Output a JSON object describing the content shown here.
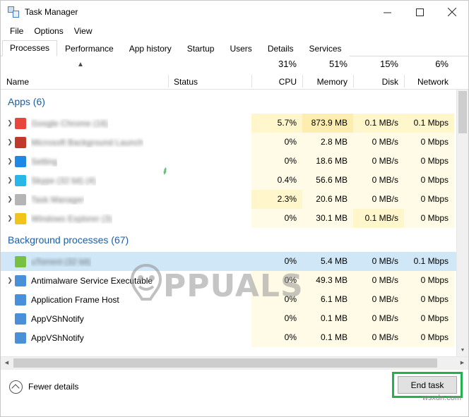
{
  "window": {
    "title": "Task Manager",
    "icon": "task-manager-icon",
    "minimize": "–",
    "maximize": "□",
    "close": "✕"
  },
  "menu": [
    "File",
    "Options",
    "View"
  ],
  "tabs": [
    {
      "label": "Processes",
      "active": true
    },
    {
      "label": "Performance",
      "active": false
    },
    {
      "label": "App history",
      "active": false
    },
    {
      "label": "Startup",
      "active": false
    },
    {
      "label": "Users",
      "active": false
    },
    {
      "label": "Details",
      "active": false
    },
    {
      "label": "Services",
      "active": false
    }
  ],
  "columns": [
    {
      "name": "Name",
      "pct": ""
    },
    {
      "name": "Status",
      "pct": ""
    },
    {
      "name": "CPU",
      "pct": "31%"
    },
    {
      "name": "Memory",
      "pct": "51%"
    },
    {
      "name": "Disk",
      "pct": "15%"
    },
    {
      "name": "Network",
      "pct": "6%"
    }
  ],
  "groups": [
    {
      "label": "Apps (6)"
    },
    {
      "label": "Background processes (67)"
    }
  ],
  "rows": [
    {
      "group": 0,
      "name": "Google Chrome (16)",
      "blurred": true,
      "icon": "#e8453c",
      "chevron": true,
      "status": "",
      "cpu": "5.7%",
      "memory": "873.9 MB",
      "disk": "0.1 MB/s",
      "network": "0.1 Mbps",
      "selected": false,
      "heat": {
        "cpu": 1,
        "memory": 2,
        "disk": 1,
        "network": 1
      }
    },
    {
      "group": 0,
      "name": "Microsoft Background Launch",
      "blurred": true,
      "icon": "#c0392b",
      "chevron": true,
      "status": "",
      "cpu": "0%",
      "memory": "2.8 MB",
      "disk": "0 MB/s",
      "network": "0 Mbps",
      "selected": false,
      "heat": {
        "cpu": 0,
        "memory": 0,
        "disk": 0,
        "network": 0
      }
    },
    {
      "group": 0,
      "name": "Setting",
      "blurred": true,
      "icon": "#1e88e5",
      "chevron": true,
      "status": "leaf",
      "cpu": "0%",
      "memory": "18.6 MB",
      "disk": "0 MB/s",
      "network": "0 Mbps",
      "selected": false,
      "heat": {
        "cpu": 0,
        "memory": 0,
        "disk": 0,
        "network": 0
      }
    },
    {
      "group": 0,
      "name": "Skype (32 bit) (4)",
      "blurred": true,
      "icon": "#29b6e8",
      "chevron": true,
      "status": "",
      "cpu": "0.4%",
      "memory": "56.6 MB",
      "disk": "0 MB/s",
      "network": "0 Mbps",
      "selected": false,
      "heat": {
        "cpu": 0,
        "memory": 0,
        "disk": 0,
        "network": 0
      }
    },
    {
      "group": 0,
      "name": "Task Manager",
      "blurred": true,
      "icon": "#b5b5b5",
      "chevron": true,
      "status": "",
      "cpu": "2.3%",
      "memory": "20.6 MB",
      "disk": "0 MB/s",
      "network": "0 Mbps",
      "selected": false,
      "heat": {
        "cpu": 1,
        "memory": 0,
        "disk": 0,
        "network": 0
      }
    },
    {
      "group": 0,
      "name": "Windows Explorer (3)",
      "blurred": true,
      "icon": "#f0c419",
      "chevron": true,
      "status": "",
      "cpu": "0%",
      "memory": "30.1 MB",
      "disk": "0.1 MB/s",
      "network": "0 Mbps",
      "selected": false,
      "heat": {
        "cpu": 0,
        "memory": 0,
        "disk": 1,
        "network": 0
      }
    },
    {
      "group": 1,
      "name": "uTorrent (32 bit)",
      "blurred": true,
      "icon": "#77c043",
      "chevron": false,
      "status": "",
      "cpu": "0%",
      "memory": "5.4 MB",
      "disk": "0 MB/s",
      "network": "0.1 Mbps",
      "selected": true,
      "heat": {
        "cpu": 0,
        "memory": 0,
        "disk": 0,
        "network": 0
      }
    },
    {
      "group": 1,
      "name": "Antimalware Service Executable",
      "blurred": false,
      "icon": "#4a90d9",
      "chevron": true,
      "status": "",
      "cpu": "0%",
      "memory": "49.3 MB",
      "disk": "0 MB/s",
      "network": "0 Mbps",
      "selected": false,
      "heat": {
        "cpu": 0,
        "memory": 0,
        "disk": 0,
        "network": 0
      }
    },
    {
      "group": 1,
      "name": "Application Frame Host",
      "blurred": false,
      "icon": "#4a90d9",
      "chevron": false,
      "status": "",
      "cpu": "0%",
      "memory": "6.1 MB",
      "disk": "0 MB/s",
      "network": "0 Mbps",
      "selected": false,
      "heat": {
        "cpu": 0,
        "memory": 0,
        "disk": 0,
        "network": 0
      }
    },
    {
      "group": 1,
      "name": "AppVShNotify",
      "blurred": false,
      "icon": "#4a90d9",
      "chevron": false,
      "status": "",
      "cpu": "0%",
      "memory": "0.1 MB",
      "disk": "0 MB/s",
      "network": "0 Mbps",
      "selected": false,
      "heat": {
        "cpu": 0,
        "memory": 0,
        "disk": 0,
        "network": 0
      }
    },
    {
      "group": 1,
      "name": "AppVShNotify",
      "blurred": false,
      "icon": "#4a90d9",
      "chevron": false,
      "status": "",
      "cpu": "0%",
      "memory": "0.1 MB",
      "disk": "0 MB/s",
      "network": "0 Mbps",
      "selected": false,
      "heat": {
        "cpu": 0,
        "memory": 0,
        "disk": 0,
        "network": 0
      }
    }
  ],
  "footer": {
    "fewer_details": "Fewer details",
    "end_task": "End task"
  },
  "watermark": {
    "text": "PPUALS",
    "source": "wsxdn.com"
  },
  "colors": {
    "highlight_green": "#22b14c",
    "selection_blue": "#cfe7f7",
    "group_header_blue": "#1a5ea8",
    "heat_light": "#fffbe6",
    "heat_mid": "#fff6cc",
    "heat_strong": "#fdeeb0"
  }
}
